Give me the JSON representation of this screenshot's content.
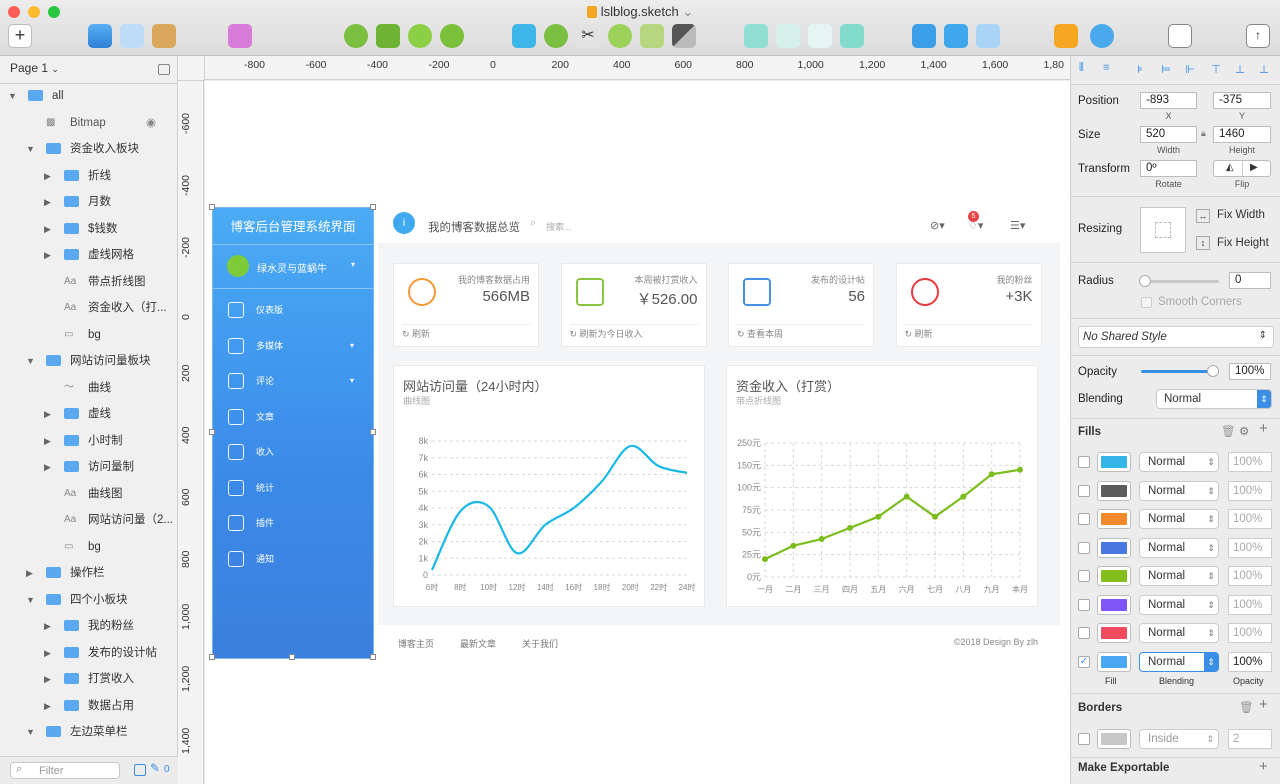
{
  "window": {
    "title": "lslblog.sketch",
    "title_caret": "⌄"
  },
  "pages": {
    "current": "Page 1"
  },
  "layers": [
    {
      "name": "all",
      "kind": "folder",
      "indent": 0,
      "expanded": true
    },
    {
      "name": "Bitmap",
      "kind": "bitmap",
      "indent": 1
    },
    {
      "name": "资金收入板块",
      "kind": "folder",
      "indent": 1,
      "expanded": true
    },
    {
      "name": "折线",
      "kind": "folder",
      "indent": 2
    },
    {
      "name": "月数",
      "kind": "folder",
      "indent": 2
    },
    {
      "name": "$钱数",
      "kind": "folder",
      "indent": 2
    },
    {
      "name": "虚线网格",
      "kind": "folder",
      "indent": 2
    },
    {
      "name": "带点折线图",
      "kind": "text",
      "indent": 2
    },
    {
      "name": "资金收入（打...",
      "kind": "text",
      "indent": 2
    },
    {
      "name": "bg",
      "kind": "rect",
      "indent": 2
    },
    {
      "name": "网站访问量板块",
      "kind": "folder",
      "indent": 1,
      "expanded": true
    },
    {
      "name": "曲线",
      "kind": "path",
      "indent": 2
    },
    {
      "name": "虚线",
      "kind": "folder",
      "indent": 2
    },
    {
      "name": "小时制",
      "kind": "folder",
      "indent": 2
    },
    {
      "name": "访问量制",
      "kind": "folder",
      "indent": 2
    },
    {
      "name": "曲线图",
      "kind": "text",
      "indent": 2
    },
    {
      "name": "网站访问量（2...",
      "kind": "text",
      "indent": 2
    },
    {
      "name": "bg",
      "kind": "rect",
      "indent": 2
    },
    {
      "name": "操作栏",
      "kind": "folder",
      "indent": 1
    },
    {
      "name": "四个小板块",
      "kind": "folder",
      "indent": 1,
      "expanded": true
    },
    {
      "name": "我的粉丝",
      "kind": "folder",
      "indent": 2
    },
    {
      "name": "发布的设计帖",
      "kind": "folder",
      "indent": 2
    },
    {
      "name": "打赏收入",
      "kind": "folder",
      "indent": 2
    },
    {
      "name": "数据占用",
      "kind": "folder",
      "indent": 2
    },
    {
      "name": "左边菜单栏",
      "kind": "folder",
      "indent": 1,
      "expanded": true
    }
  ],
  "filter": {
    "placeholder": "Filter",
    "count": "0"
  },
  "ruler": {
    "top": [
      "-800",
      "-600",
      "-400",
      "-200",
      "0",
      "200",
      "400",
      "600",
      "800",
      "1,000",
      "1,200",
      "1,400",
      "1,600",
      "1,80"
    ],
    "left": [
      "-600",
      "-400",
      "-200",
      "0",
      "200",
      "400",
      "600",
      "800",
      "1,000",
      "1,200",
      "1,400"
    ]
  },
  "artboard": {
    "sidebar": {
      "title": "博客后台管理系统界面",
      "user": "绿水灵与蓝蜗牛",
      "menu": [
        "仪表版",
        "多媒体",
        "评论",
        "文章",
        "收入",
        "统计",
        "插件",
        "通知"
      ]
    },
    "header": {
      "title": "我的博客数据总览",
      "search": "搜索...",
      "badge": "5"
    },
    "cards": [
      {
        "caption": "我的博客数据占用",
        "value": "566MB",
        "footer": "刷新",
        "color": "#f39a38"
      },
      {
        "caption": "本周被打赏收入",
        "value": "￥526.00",
        "footer": "刷新为今日收入",
        "color": "#8cc63f"
      },
      {
        "caption": "发布的设计帖",
        "value": "56",
        "footer": "查看本周",
        "color": "#4a90e2"
      },
      {
        "caption": "我的粉丝",
        "value": "+3K",
        "footer": "刷新",
        "color": "#e8393f"
      }
    ],
    "footer": {
      "links": [
        "博客主页",
        "最新文章",
        "关于我们"
      ],
      "copyright": "©2018 Design By zlh"
    }
  },
  "chart_data": [
    {
      "type": "line",
      "title": "网站访问量（24小时内）",
      "subtitle": "曲线图",
      "categories": [
        "6时",
        "8时",
        "10时",
        "12时",
        "14时",
        "16时",
        "18时",
        "20时",
        "22时",
        "24时"
      ],
      "ytick_labels": [
        "0",
        "1k",
        "2k",
        "3k",
        "4k",
        "5k",
        "6k",
        "7k",
        "8k"
      ],
      "ylim": [
        0,
        8000
      ],
      "smooth": true,
      "color": "#1ab8e4",
      "grid": "horizontal-dashed",
      "values": [
        300,
        3800,
        4100,
        1300,
        3000,
        4000,
        5600,
        7700,
        6500,
        6100
      ]
    },
    {
      "type": "line",
      "title": "资金收入（打赏）",
      "subtitle": "带点折线图",
      "categories": [
        "一月",
        "二月",
        "三月",
        "四月",
        "五月",
        "六月",
        "七月",
        "八月",
        "九月",
        "本月"
      ],
      "ytick_labels": [
        "0元",
        "25元",
        "50元",
        "75元",
        "100元",
        "150元",
        "250元"
      ],
      "ylim": [
        0,
        6
      ],
      "markers": true,
      "color": "#7cbd1e",
      "grid": "dashed",
      "values": [
        0.8,
        1.4,
        1.7,
        2.2,
        2.7,
        3.6,
        2.7,
        3.6,
        4.6,
        4.8
      ]
    }
  ],
  "inspector": {
    "position": {
      "label": "Position",
      "x": "-893",
      "y": "-375",
      "x_sub": "X",
      "y_sub": "Y"
    },
    "size": {
      "label": "Size",
      "w": "520",
      "h": "1460",
      "w_sub": "Width",
      "h_sub": "Height"
    },
    "transform": {
      "label": "Transform",
      "rotate": "0º",
      "rotate_sub": "Rotate",
      "flip_sub": "Flip"
    },
    "resizing": {
      "label": "Resizing",
      "fix_width": "Fix Width",
      "fix_height": "Fix Height"
    },
    "radius": {
      "label": "Radius",
      "value": "0",
      "smooth": "Smooth Corners"
    },
    "shared_style": "No Shared Style",
    "opacity": {
      "label": "Opacity",
      "value": "100%"
    },
    "blending": {
      "label": "Blending",
      "value": "Normal"
    },
    "fills": {
      "label": "Fills",
      "rows": [
        {
          "color": "#34b6e8",
          "blend": "Normal",
          "opacity": "100%",
          "checked": false
        },
        {
          "color": "#5b5b5b",
          "blend": "Normal",
          "opacity": "100%",
          "checked": false
        },
        {
          "color": "#f08a2c",
          "blend": "Normal",
          "opacity": "100%",
          "checked": false
        },
        {
          "color": "#4978e0",
          "blend": "Normal",
          "opacity": "100%",
          "checked": false
        },
        {
          "color": "#84bf1f",
          "blend": "Normal",
          "opacity": "100%",
          "checked": false
        },
        {
          "color": "#7d56f5",
          "blend": "Normal",
          "opacity": "100%",
          "checked": false
        },
        {
          "color": "#ef4c5f",
          "blend": "Normal",
          "opacity": "100%",
          "checked": false
        },
        {
          "color": "#4aa7f3",
          "blend": "Normal",
          "opacity": "100%",
          "checked": true
        }
      ],
      "col_fill": "Fill",
      "col_blend": "Blending",
      "col_opacity": "Opacity"
    },
    "borders": {
      "label": "Borders",
      "position": "Inside",
      "width": "2"
    },
    "export": {
      "label": "Make Exportable"
    }
  }
}
